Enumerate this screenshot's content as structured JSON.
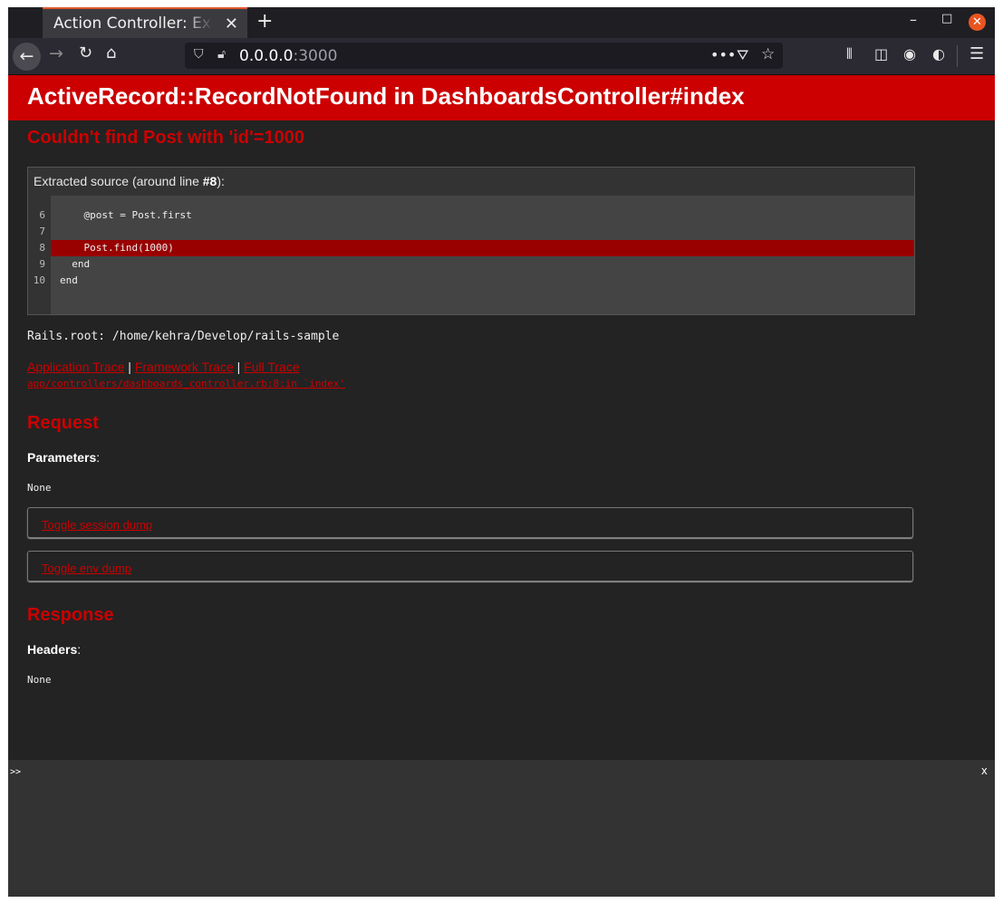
{
  "browser": {
    "tab_title": "Action Controller: Exception caught",
    "tab_close": "✕",
    "new_tab": "+",
    "url_host": "0.0.0.0",
    "url_port": ":3000"
  },
  "page": {
    "error_title": "ActiveRecord::RecordNotFound in DashboardsController#index",
    "error_message": "Couldn't find Post with 'id'=1000",
    "source": {
      "info_prefix": "Extracted source (around line ",
      "line_ref": "#8",
      "info_suffix": "):",
      "lines": [
        {
          "num": "6",
          "code": "    @post = Post.first"
        },
        {
          "num": "7",
          "code": ""
        },
        {
          "num": "8",
          "code": "    Post.find(1000)"
        },
        {
          "num": "9",
          "code": "  end"
        },
        {
          "num": "10",
          "code": "end"
        }
      ],
      "highlighted_line": "8"
    },
    "rails_root": "Rails.root: /home/kehra/Develop/rails-sample",
    "trace": {
      "application": "Application Trace",
      "framework": "Framework Trace",
      "full": "Full Trace",
      "separator": "|",
      "path": "app/controllers/dashboards_controller.rb:8:in `index'"
    },
    "request": {
      "title": "Request",
      "params_label": "Parameters",
      "params_value": "None",
      "toggle_session": "Toggle session dump",
      "toggle_env": "Toggle env dump"
    },
    "response": {
      "title": "Response",
      "headers_label": "Headers",
      "headers_value": "None"
    }
  },
  "console": {
    "prompt": ">>",
    "close": "x"
  }
}
